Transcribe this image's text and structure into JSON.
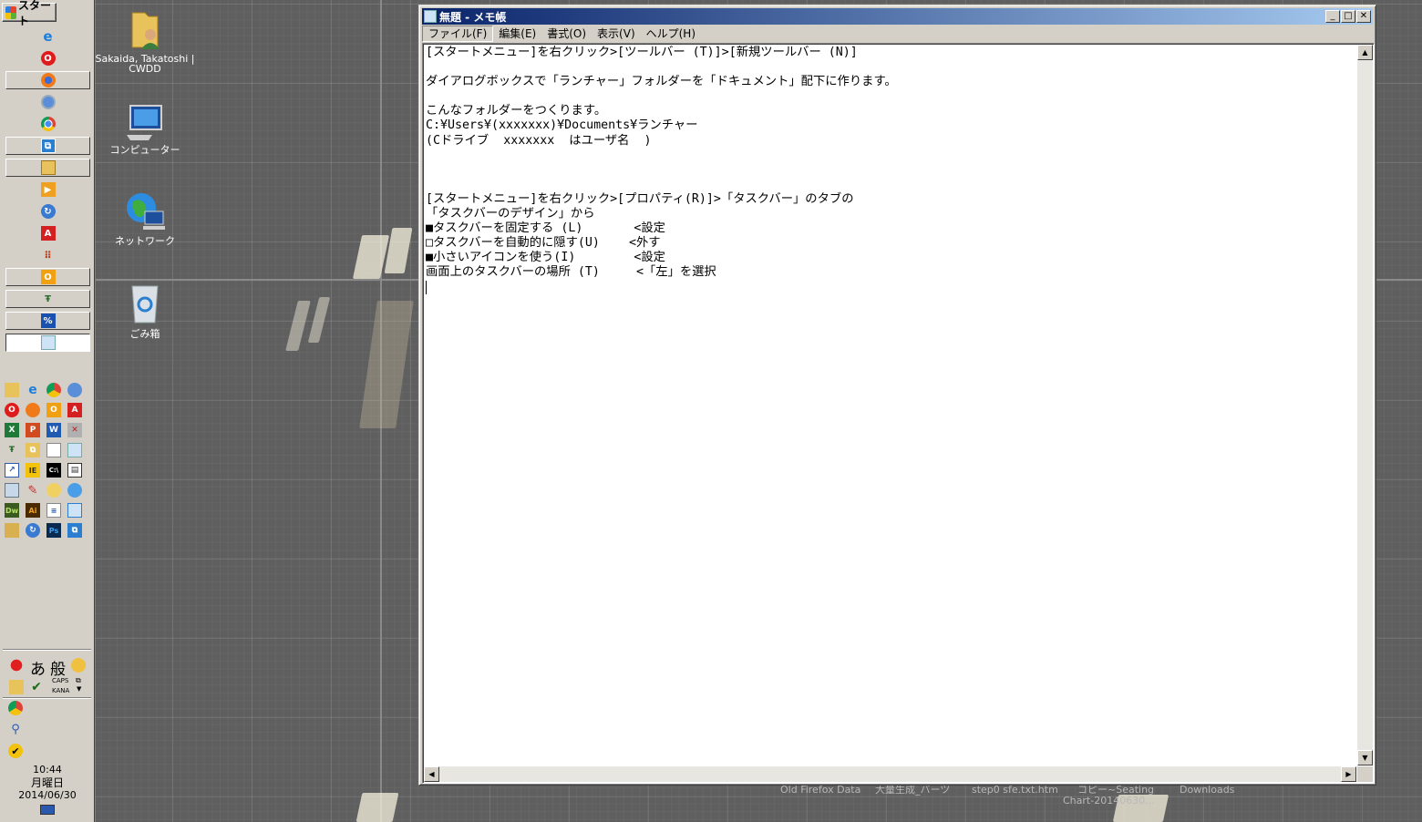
{
  "taskbar": {
    "start_label": "スタート",
    "clock": {
      "time": "10:44",
      "day": "月曜日",
      "date": "2014/06/30"
    },
    "ime": {
      "mode1": "あ",
      "mode2": "般",
      "caps": "CAPS",
      "kana": "KANA"
    }
  },
  "desktop": {
    "icons": [
      {
        "label": "Sakaida, Takatoshi | CWDD"
      },
      {
        "label": "コンピューター"
      },
      {
        "label": "ネットワーク"
      },
      {
        "label": "ごみ箱"
      }
    ],
    "hidden_labels": [
      "Old Firefox Data",
      "大量生成_バーツ",
      "step0 sfe.txt.htm",
      "コピー~Seating",
      "Chart-20140630...",
      "Downloads"
    ]
  },
  "notepad": {
    "title": "無題 - メモ帳",
    "menu": [
      "ファイル(F)",
      "編集(E)",
      "書式(O)",
      "表示(V)",
      "ヘルプ(H)"
    ],
    "lines": [
      "[スタートメニュー]を右クリック>[ツールバー (T)]>[新規ツールバー (N)]",
      "",
      "ダイアログボックスで「ランチャー」フォルダーを「ドキュメント」配下に作ります。",
      "",
      "こんなフォルダーをつくります。",
      "C:¥Users¥(xxxxxxx)¥Documents¥ランチャー",
      "(Cドライブ  xxxxxxx  はユーザ名  )",
      "",
      "",
      "",
      "[スタートメニュー]を右クリック>[プロパティ(R)]>「タスクバー」のタブの",
      "「タスクバーのデザイン」から",
      "■タスクバーを固定する (L)       <設定",
      "□タスクバーを自動的に隠す(U)    <外す",
      "■小さいアイコンを使う(I)        <設定",
      "画面上のタスクバーの場所 (T)     <「左」を選択"
    ]
  },
  "colors": {
    "taskbar": "#d4d0c8",
    "titlebar_start": "#0a246a",
    "titlebar_end": "#a6caf0",
    "desktop": "#5f5f5f"
  }
}
